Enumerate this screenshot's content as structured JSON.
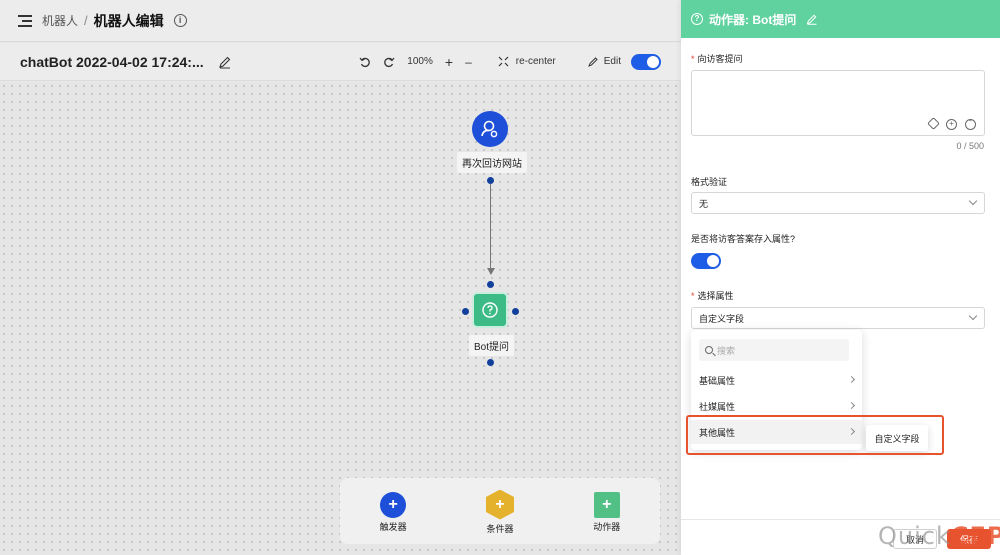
{
  "breadcrumb": {
    "parent": "机器人",
    "separator": "/",
    "current": "机器人编辑"
  },
  "toolbar": {
    "flow_title": "chatBot 2022-04-02 17:24:...",
    "zoom": "100%",
    "plus": "+",
    "minus": "–",
    "recenter": "re-center",
    "edit": "Edit"
  },
  "canvas": {
    "trigger_node_label": "再次回访网站",
    "bot_node_label": "Bot提问"
  },
  "dock": {
    "trigger": "触发器",
    "condition": "条件器",
    "action": "动作器",
    "plus": "+"
  },
  "panel": {
    "title": "动作器: Bot提问",
    "question_label": "向访客提问",
    "required_mark": "*",
    "counter": "0 / 500",
    "format_label": "格式验证",
    "format_value": "无",
    "save_attr_label": "是否将访客答案存入属性?",
    "attr_label": "选择属性",
    "attr_value": "自定义字段",
    "search_placeholder": "搜索",
    "dropdown_items": [
      "基础属性",
      "社媒属性",
      "其他属性"
    ],
    "submenu_item": "自定义字段",
    "cancel": "取消",
    "save": "保存"
  },
  "watermark": {
    "prefix": "Quick",
    "suffix": "CEP"
  },
  "colors": {
    "accent": "#1d4fd8",
    "header_green": "#60d2a0",
    "highlight": "#e8532f"
  }
}
